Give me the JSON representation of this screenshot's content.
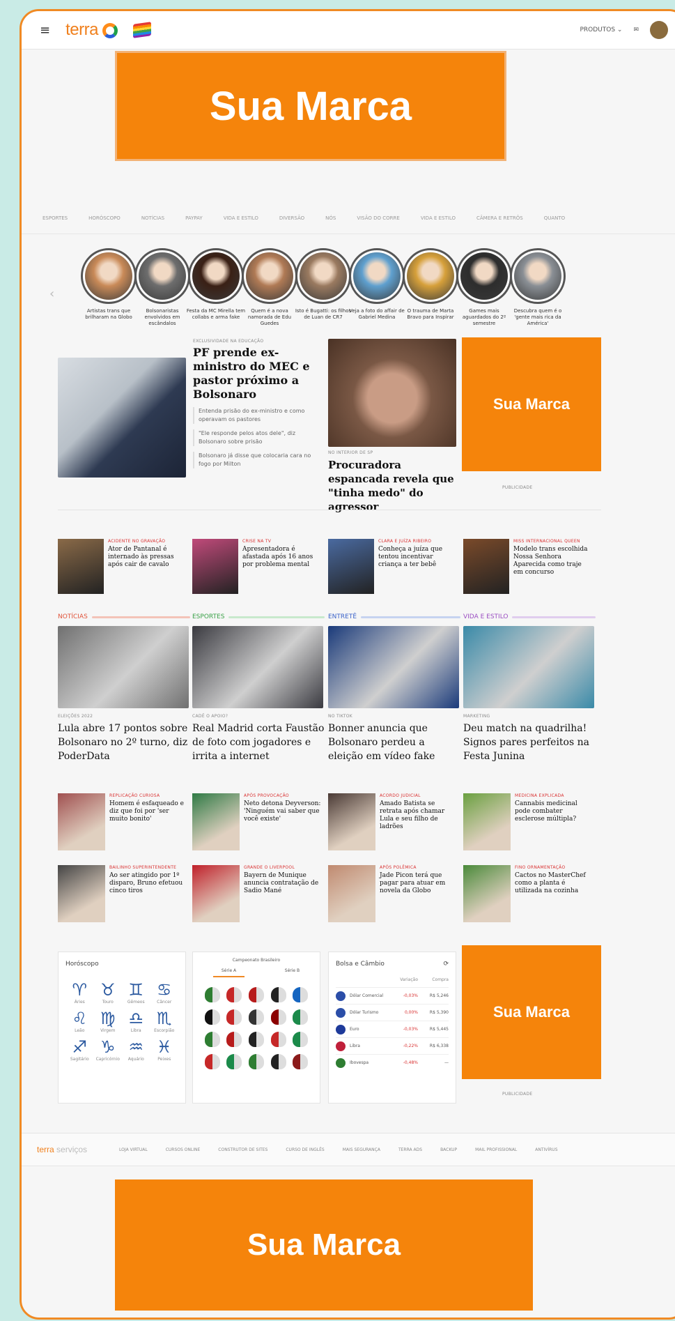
{
  "header": {
    "brand": "terra",
    "products_label": "PRODUTOS"
  },
  "ads": {
    "label": "Sua Marca",
    "publicidade": "PUBLICIDADE"
  },
  "nav": [
    "ESPORTES",
    "HORÓSCOPO",
    "NOTÍCIAS",
    "PAYPAY",
    "VIDA E ESTILO",
    "DIVERSÃO",
    "NÓS",
    "VISÃO DO CORRE",
    "VIDA E ESTILO",
    "CÂMERA E RETRÔS",
    "QUANTO"
  ],
  "stories": [
    {
      "caption": "Artistas trans que brilharam na Globo",
      "color": "#c98a58"
    },
    {
      "caption": "Bolsonaristas envolvidos em escândalos",
      "color": "#6d6d6d"
    },
    {
      "caption": "Festa da MC Mirella tem collabs e arma fake",
      "color": "#3a2015"
    },
    {
      "caption": "Quem é a nova namorada de Edu Guedes",
      "color": "#b07a55"
    },
    {
      "caption": "Isto é Bugatti: os filhos de Luan de CR7",
      "color": "#9a7a60"
    },
    {
      "caption": "Veja a foto do affair de Gabriel Medina",
      "color": "#5fa0cf"
    },
    {
      "caption": "O trauma de Marta Bravo para Inspirar",
      "color": "#d6a03a"
    },
    {
      "caption": "Games mais aguardados do 2º semestre",
      "color": "#2d2d2d"
    },
    {
      "caption": "Descubra quem é o 'gente mais rica da América'",
      "color": "#8a8f95"
    }
  ],
  "top": {
    "main_kicker": "EXCLUSIVIDADE NA EDUCAÇÃO",
    "main_title": "PF prende ex-ministro do MEC e pastor próximo a Bolsonaro",
    "subs": [
      "Entenda prisão do ex-ministro e como operavam os pastores",
      "\"Ele responde pelos atos dele\", diz Bolsonaro sobre prisão",
      "Bolsonaro já disse que colocaria cara no fogo por Milton"
    ],
    "second_kicker": "NO INTERIOR DE SP",
    "second_title": "Procuradora espancada revela que \"tinha medo\" do agressor"
  },
  "minis": [
    {
      "kicker": "ACIDENTE NO GRAVAÇÃO",
      "title": "Ator de Pantanal é internado às pressas após cair de cavalo",
      "color": "#8a6a48"
    },
    {
      "kicker": "CRISE NA TV",
      "title": "Apresentadora é afastada após 16 anos por problema mental",
      "color": "#c04a7a"
    },
    {
      "kicker": "CLARA E JUÍZA RIBEIRO",
      "title": "Conheça a juíza que tentou incentivar criança a ter bebê",
      "color": "#4a6aa0"
    },
    {
      "kicker": "MISS INTERNACIONAL QUEEN",
      "title": "Modelo trans escolhida Nossa Senhora Aparecida como traje em concurso",
      "color": "#7a4a2a"
    }
  ],
  "sections": [
    {
      "name": "NOTÍCIAS",
      "color": "#e0533a",
      "line": "#f3c3b8",
      "kicker": "ELEIÇÕES 2022",
      "title": "Lula abre 17 pontos sobre Bolsonaro no 2º turno, diz PoderData",
      "img": "#707070",
      "items": [
        {
          "kicker": "REPLICAÇÃO CURIOSA",
          "title": "Homem é esfaqueado e diz que foi por 'ser muito bonito'",
          "color": "#a05050"
        },
        {
          "kicker": "BAILINHO SUPERINTENDENTE",
          "title": "Ao ser atingido por 1º disparo, Bruno efetuou cinco tiros",
          "color": "#444"
        }
      ]
    },
    {
      "name": "ESPORTES",
      "color": "#3aa148",
      "line": "#c8e9cc",
      "kicker": "CADÊ O APOIO?",
      "title": "Real Madrid corta Faustão de foto com jogadores e irrita a internet",
      "img": "#3a3a40",
      "items": [
        {
          "kicker": "APÓS PROVOCAÇÃO",
          "title": "Neto detona Deyverson: 'Ninguém vai saber que você existe'",
          "color": "#2f7a45"
        },
        {
          "kicker": "GRANDE O LIVERPOOL",
          "title": "Bayern de Munique anuncia contratação de Sadio Mané",
          "color": "#c0202a"
        }
      ]
    },
    {
      "name": "ENTRETÊ",
      "color": "#3a62c9",
      "line": "#c6d3f0",
      "kicker": "NO TIKTOK",
      "title": "Bonner anuncia que Bolsonaro perdeu a eleição em vídeo fake",
      "img": "#1a3a7a",
      "items": [
        {
          "kicker": "ACORDO JUDICIAL",
          "title": "Amado Batista se retrata após chamar Lula e seu filho de ladrões",
          "color": "#4a3a35"
        },
        {
          "kicker": "APÓS POLÊMICA",
          "title": "Jade Picon terá que pagar para atuar em novela da Globo",
          "color": "#c08a70"
        }
      ]
    },
    {
      "name": "VIDA E ESTILO",
      "color": "#9a4dc2",
      "line": "#e0cdee",
      "kicker": "MARKETING",
      "title": "Deu match na quadrilha! Signos pares perfeitos na Festa Junina",
      "img": "#3a8aa8",
      "items": [
        {
          "kicker": "MEDICINA EXPLICADA",
          "title": "Cannabis medicinal pode combater esclerose múltipla?",
          "color": "#6aa040"
        },
        {
          "kicker": "FINO ORNAMENTAÇÃO",
          "title": "Cactos no MasterChef como a planta é utilizada na cozinha",
          "color": "#4a8a3a"
        }
      ]
    }
  ],
  "horoscope": {
    "title": "Horóscopo",
    "signs": [
      {
        "g": "♈",
        "n": "Áries"
      },
      {
        "g": "♉",
        "n": "Touro"
      },
      {
        "g": "♊",
        "n": "Gêmeos"
      },
      {
        "g": "♋",
        "n": "Câncer"
      },
      {
        "g": "♌",
        "n": "Leão"
      },
      {
        "g": "♍",
        "n": "Virgem"
      },
      {
        "g": "♎",
        "n": "Libra"
      },
      {
        "g": "♏",
        "n": "Escorpião"
      },
      {
        "g": "♐",
        "n": "Sagitário"
      },
      {
        "g": "♑",
        "n": "Capricórnio"
      },
      {
        "g": "♒",
        "n": "Aquário"
      },
      {
        "g": "♓",
        "n": "Peixes"
      }
    ]
  },
  "championship": {
    "title": "Campeonato Brasileiro",
    "tab_a": "Série A",
    "tab_b": "Série B",
    "clubs": [
      "#2e7d32",
      "#c62828",
      "#b71c1c",
      "#222",
      "#1565c0",
      "#111",
      "#c62828",
      "#333",
      "#8b0000",
      "#1b8a4a",
      "#2e7d32",
      "#b71c1c",
      "#222",
      "#c62828",
      "#1b8a4a",
      "#c62828",
      "#1b8a4a",
      "#2e7d32",
      "#222",
      "#8b1a1a"
    ]
  },
  "fx": {
    "title": "Bolsa e Câmbio",
    "col_var": "Variação",
    "col_buy": "Compra",
    "rows": [
      {
        "name": "Dólar Comercial",
        "var": "-0,03%",
        "buy": "R$ 5,246",
        "flag": "#2b4ea8"
      },
      {
        "name": "Dólar Turismo",
        "var": "0,00%",
        "buy": "R$ 5,390",
        "flag": "#2b4ea8"
      },
      {
        "name": "Euro",
        "var": "-0,03%",
        "buy": "R$ 5,445",
        "flag": "#1e3a9a"
      },
      {
        "name": "Libra",
        "var": "-0,22%",
        "buy": "R$ 6,338",
        "flag": "#c0203a"
      },
      {
        "name": "Ibovespa",
        "var": "-0,48%",
        "buy": "—",
        "flag": "#2e7d32"
      }
    ]
  },
  "footer": {
    "brand": "terra",
    "brand_suffix": "serviços",
    "links": [
      "LOJA VIRTUAL",
      "CURSOS ONLINE",
      "CONSTRUTOR DE SITES",
      "CURSO DE INGLÊS",
      "MAIS SEGURANÇA",
      "TERRA ADS",
      "BACKUP",
      "MAIL PROFISSIONAL",
      "ANTIVÍRUS"
    ]
  }
}
